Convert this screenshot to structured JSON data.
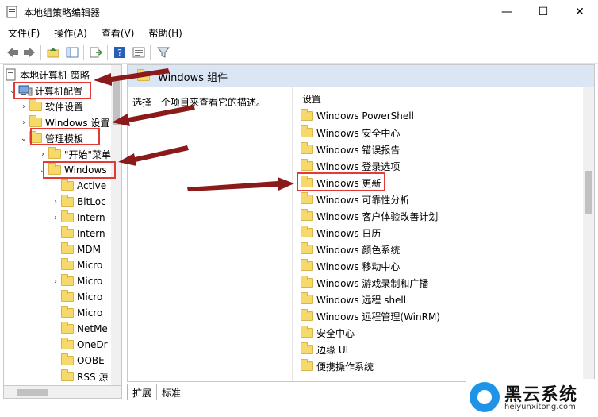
{
  "window": {
    "title": "本地组策略编辑器",
    "controls": {
      "minimize": "—",
      "maximize": "☐",
      "close": "✕"
    }
  },
  "menu": [
    "文件(F)",
    "操作(A)",
    "查看(V)",
    "帮助(H)"
  ],
  "tree": {
    "root": "本地计算机 策略",
    "nodes": [
      "计算机配置",
      "软件设置",
      "Windows 设置",
      "管理模板",
      "\"开始\"菜单",
      "Windows",
      "Active",
      "BitLoc",
      "Intern",
      "Intern",
      "MDM",
      "Micro",
      "Micro",
      "Micro",
      "Micro",
      "NetMe",
      "OneDr",
      "OOBE",
      "RSS 源"
    ]
  },
  "right": {
    "header": "Windows 组件",
    "description": "选择一个项目来查看它的描述。",
    "settings_header": "设置",
    "items": [
      "Windows PowerShell",
      "Windows 安全中心",
      "Windows 错误报告",
      "Windows 登录选项",
      "Windows 更新",
      "Windows 可靠性分析",
      "Windows 客户体验改善计划",
      "Windows 日历",
      "Windows 颜色系统",
      "Windows 移动中心",
      "Windows 游戏录制和广播",
      "Windows 远程 shell",
      "Windows 远程管理(WinRM)",
      "安全中心",
      "边缘 UI",
      "便携操作系统"
    ]
  },
  "tabs": [
    "扩展",
    "标准"
  ],
  "watermark": {
    "brand": "黑云系统",
    "url": "heiyunxitong.com"
  },
  "colors": {
    "header_bg": "#dbe6f4",
    "highlight": "#e53935",
    "arrow": "#8b1a1a",
    "folder": "#f6d96b"
  }
}
